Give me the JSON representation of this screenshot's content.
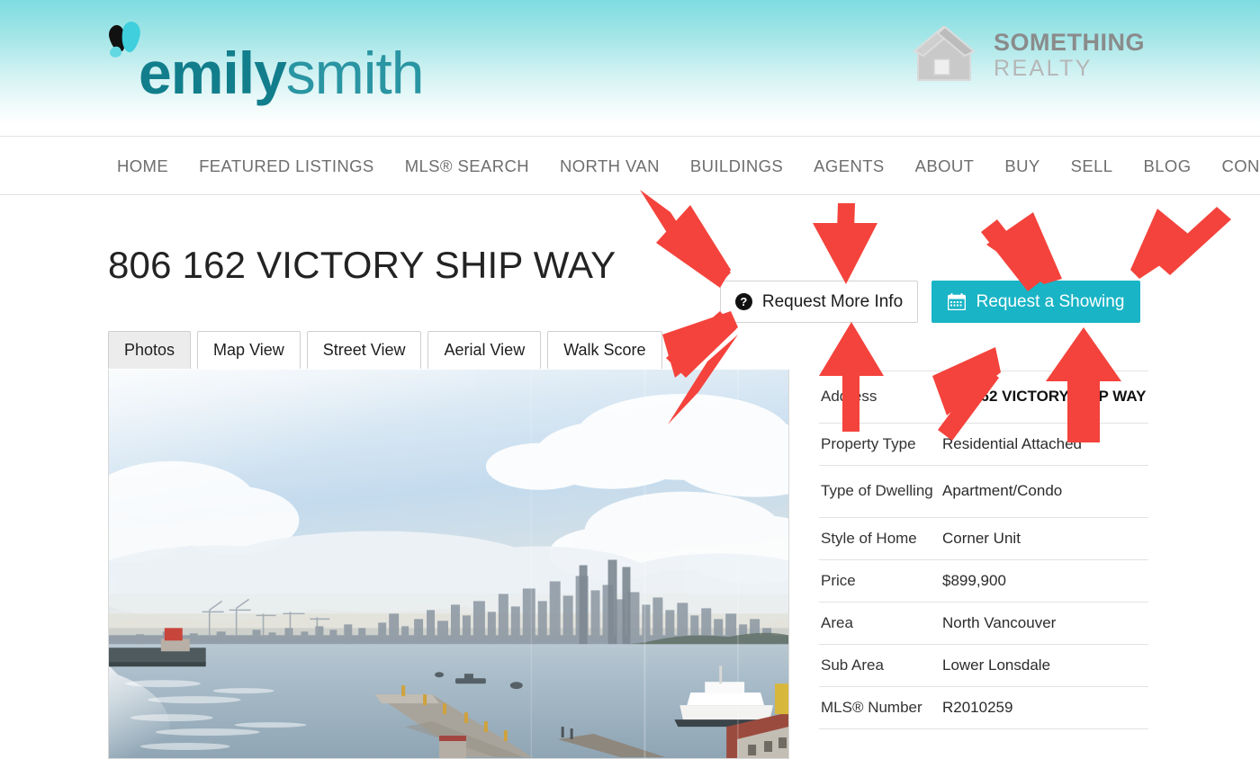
{
  "brand": {
    "name_bold": "emily",
    "name_light": "smith",
    "mark_icon": "leaf-logo-icon"
  },
  "realty": {
    "line1": "SOMETHING",
    "line2": "REALTY",
    "icon": "house-icon"
  },
  "nav": {
    "items": [
      {
        "label": "HOME",
        "name": "home"
      },
      {
        "label": "FEATURED LISTINGS",
        "name": "featured-listings"
      },
      {
        "label": "MLS® SEARCH",
        "name": "mls-search"
      },
      {
        "label": "NORTH VAN",
        "name": "north-van"
      },
      {
        "label": "BUILDINGS",
        "name": "buildings"
      },
      {
        "label": "AGENTS",
        "name": "agents"
      },
      {
        "label": "ABOUT",
        "name": "about"
      },
      {
        "label": "BUY",
        "name": "buy"
      },
      {
        "label": "SELL",
        "name": "sell"
      },
      {
        "label": "BLOG",
        "name": "blog"
      },
      {
        "label": "CONTACT",
        "name": "contact"
      }
    ]
  },
  "listing": {
    "title": "806 162 VICTORY SHIP WAY"
  },
  "actions": {
    "request_info_label": "Request More Info",
    "request_info_icon": "question-mark-circle-icon",
    "request_showing_label": "Request a Showing",
    "request_showing_icon": "calendar-icon",
    "showing_button_color": "#19b4c6"
  },
  "tabs": {
    "items": [
      {
        "label": "Photos",
        "active": true
      },
      {
        "label": "Map View",
        "active": false
      },
      {
        "label": "Street View",
        "active": false
      },
      {
        "label": "Aerial View",
        "active": false
      },
      {
        "label": "Walk Score",
        "active": false
      }
    ]
  },
  "photo": {
    "alt": "Waterfront view of downtown Vancouver skyline across the harbour with pier and yacht"
  },
  "details": {
    "rows": [
      {
        "label": "Address",
        "value": "806 162 VICTORY SHIP WAY",
        "bold": true,
        "tall": true
      },
      {
        "label": "Property Type",
        "value": "Residential Attached",
        "bold": false,
        "tall": false
      },
      {
        "label": "Type of Dwelling",
        "value": "Apartment/Condo",
        "bold": false,
        "tall": true
      },
      {
        "label": "Style of Home",
        "value": "Corner Unit",
        "bold": false,
        "tall": false
      },
      {
        "label": "Price",
        "value": "$899,900",
        "bold": false,
        "tall": false
      },
      {
        "label": "Area",
        "value": "North Vancouver",
        "bold": false,
        "tall": false
      },
      {
        "label": "Sub Area",
        "value": "Lower Lonsdale",
        "bold": false,
        "tall": false
      },
      {
        "label": "MLS® Number",
        "value": "R2010259",
        "bold": false,
        "tall": false
      }
    ]
  },
  "annotations": {
    "arrow_color": "#f4433c",
    "count": 8,
    "description": "Red arrows pointing at Request More Info and Request a Showing buttons"
  }
}
